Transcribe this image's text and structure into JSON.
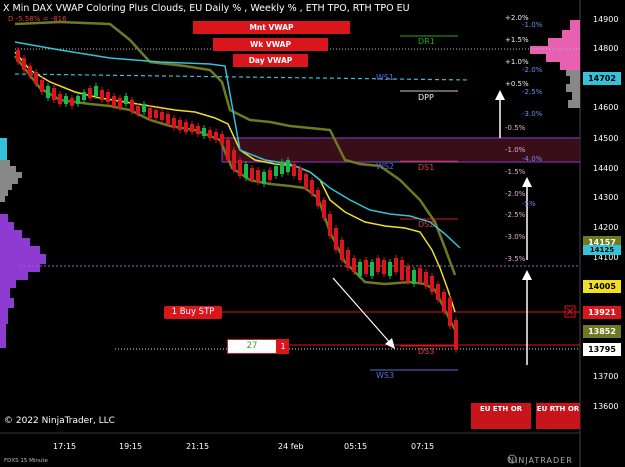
{
  "header": {
    "title": "X Min DAX VWAP Coloring Plus Clouds, EU Daily % , Weekly % , ETH TPO, RTH TPO EU",
    "subtitle": "D -5.58% = -816"
  },
  "vwap_buttons": [
    "Mnt VWAP",
    "Wk VWAP",
    "Day VWAP"
  ],
  "pivot_labels": {
    "dr1": "DR1",
    "dpp": "DPP",
    "ws1": "WS1",
    "ws2": "WS2",
    "ds1": "DS1",
    "ds2": "DS2",
    "ds3": "DS3",
    "ws3": "WS3"
  },
  "percent_labels": {
    "white": [
      "+2.0%",
      "+1.5%",
      "+1.0%",
      "+0.5%",
      "-0.5%",
      "-1.0%",
      "-1.5%",
      "-2.0%",
      "-2.5%",
      "-3.0%",
      "-3.5%"
    ],
    "blue": [
      "-1.0%",
      "-2.0%",
      "-2.5%",
      "-3.0%",
      "-4.0%",
      "-5%"
    ]
  },
  "y_axis": [
    "14900",
    "14800",
    "14700",
    "14600",
    "14500",
    "14400",
    "14300",
    "14200",
    "14100",
    "14000",
    "13900",
    "13800",
    "13700",
    "13600"
  ],
  "x_axis": [
    "17:15",
    "19:15",
    "21:15",
    "24 feb",
    "05:15",
    "07:15"
  ],
  "price_tags": {
    "t14702": "14702",
    "t14157": "14157",
    "t14125": "14125",
    "t14005": "14005",
    "t13921": "13921",
    "t13852": "13852",
    "t13795": "13795"
  },
  "order": {
    "buy_label": "1 Buy STP",
    "quantity": "27",
    "qty_btn": "1",
    "close_symbol": "X"
  },
  "session_buttons": {
    "eth": "EU ETH OR",
    "rth": "EU RTH OR"
  },
  "footer": {
    "copyright": "© 2022 NinjaTrader, LLC",
    "instrument": "FDXS 15 Minute",
    "brand": "NINJATRADER"
  },
  "colors": {
    "up": "#1db84a",
    "down": "#d9161c",
    "vwap_yellow": "#f0e020",
    "olive": "#6e7a1e",
    "cyan": "#35c2d8",
    "purple": "#8e3bd1",
    "pink": "#e860b0"
  }
}
